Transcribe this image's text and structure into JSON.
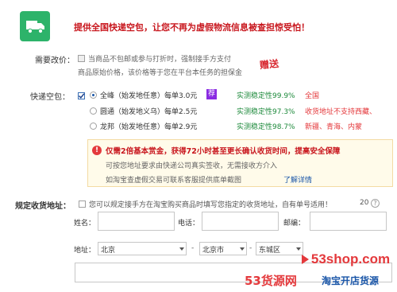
{
  "banner": {
    "text": "提供全国快递空包，让您不再为虚假物流信息被查担惊受怕！",
    "icon": "truck-icon",
    "icon_color": "#2db36a"
  },
  "price_change": {
    "label": "需要改价：",
    "line1": "当商品不包邮或参与打折时，强制接手方支付",
    "line2": "商品原始价格，该价格等于您在平台本任务的担保金",
    "stamp": "赠送"
  },
  "express": {
    "label": "快递空包：",
    "options": [
      {
        "name": "全峰（始发地任意）每单3.0元",
        "badge": "荐",
        "stability": "实测稳定性99.9%",
        "note": "全国"
      },
      {
        "name": "圆通（始发地义乌）每单2.5元",
        "badge": "",
        "stability": "实测稳定性97.3%",
        "note": "收货地址不支持西藏、"
      },
      {
        "name": "龙邦（始发地任意）每单2.9元",
        "badge": "",
        "stability": "实测稳定性98.7%",
        "note": "新疆、青海、内蒙"
      }
    ]
  },
  "notice": {
    "title": "仅需2倍基本赏金，获得72小时甚至更长确认收货时间，提高安全保障",
    "line2": "可按您地址要求由快递公司真实签收，无需接收方介入",
    "line3": "如淘宝查虚假交易可联系客服提供底单截图",
    "link": "了解详情"
  },
  "address": {
    "label": "规定收货地址：",
    "desc": "您可以规定接手方在淘宝购买商品时填写您指定的收货地址，自有单号适用！",
    "count": "20",
    "name_label": "姓名：",
    "phone_label": "电话：",
    "zip_label": "邮编：",
    "addr_label": "地址：",
    "province": "北京",
    "city": "北京市",
    "district": "东城区",
    "sep": "-"
  },
  "watermark": {
    "site": "53shop.com",
    "logo_text": "53货源网",
    "slogan": "淘宝开店货源"
  }
}
